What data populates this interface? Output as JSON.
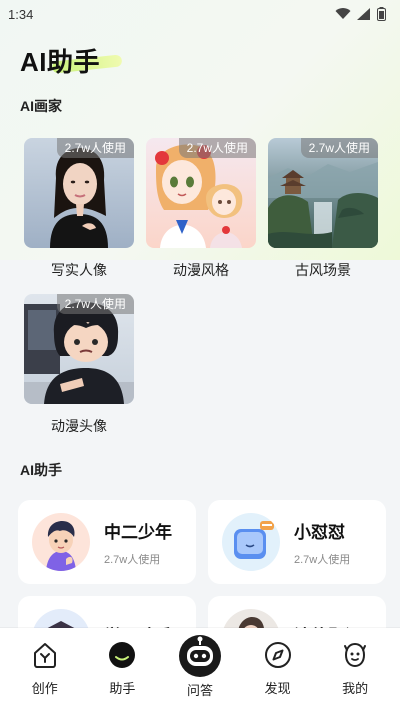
{
  "status_bar": {
    "time": "1:34"
  },
  "header": {
    "title": "AI助手"
  },
  "sections": {
    "painter_title": "AI画家",
    "assistant_title": "AI助手"
  },
  "painters": [
    {
      "label": "写实人像",
      "usage": "2.7w人使用",
      "icon": "portrait-thumbnail"
    },
    {
      "label": "动漫风格",
      "usage": "2.7w人使用",
      "icon": "anime-thumbnail"
    },
    {
      "label": "古风场景",
      "usage": "2.7w人使用",
      "icon": "ancient-landscape-thumbnail"
    },
    {
      "label": "动漫头像",
      "usage": "2.7w人使用",
      "icon": "anime-avatar-thumbnail"
    }
  ],
  "assistants": [
    {
      "name": "中二少年",
      "usage": "2.7w人使用",
      "icon": "boy-avatar"
    },
    {
      "name": "小怼怼",
      "usage": "2.7w人使用",
      "icon": "blue-robot-avatar"
    },
    {
      "name": "学习助手",
      "usage": "",
      "icon": "study-avatar"
    },
    {
      "name": "法律顾问",
      "usage": "",
      "icon": "lawyer-avatar"
    }
  ],
  "nav": {
    "items": [
      {
        "label": "创作",
        "icon": "create-icon"
      },
      {
        "label": "助手",
        "icon": "assistant-icon"
      },
      {
        "label": "问答",
        "icon": "robot-icon"
      },
      {
        "label": "发现",
        "icon": "compass-icon"
      },
      {
        "label": "我的",
        "icon": "profile-icon"
      }
    ]
  },
  "colors": {
    "accent_green": "#c9f27a",
    "active_icon": "#111111",
    "background": "#f3f5f7"
  }
}
